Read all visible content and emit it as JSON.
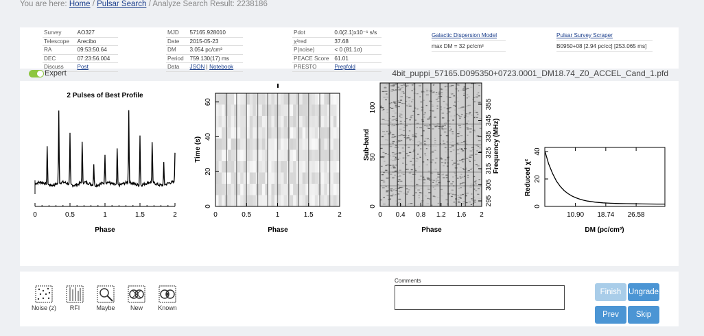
{
  "breadcrumb": {
    "prefix": "You are here:",
    "home": "Home",
    "sep1": "/",
    "search": "Pulsar Search",
    "sep2": "/",
    "current": "Analyze Search Result: 2238186"
  },
  "meta": {
    "col1": [
      {
        "k": "Survey",
        "v": "AO327"
      },
      {
        "k": "Telescope",
        "v": "Arecibo"
      },
      {
        "k": "RA",
        "v": "09:53:50.64"
      },
      {
        "k": "DEC",
        "v": "07:23:56.004"
      },
      {
        "k": "Discuss",
        "v": "Post",
        "link": true
      }
    ],
    "col2": [
      {
        "k": "MJD",
        "v": "57165.928010"
      },
      {
        "k": "Date",
        "v": "2015-05-23"
      },
      {
        "k": "DM",
        "v": "3.054 pc/cm³"
      },
      {
        "k": "Period",
        "v": "759.130(17) ms"
      }
    ],
    "col2_data": {
      "k": "Data",
      "json": "JSON",
      "sep": "|",
      "notebook": "Notebook"
    },
    "col3": [
      {
        "k": "Pdot",
        "v": "0.0(2.1)x10⁻⁶ s/s"
      },
      {
        "k": "χ²red",
        "v": "37.68"
      },
      {
        "k": "P(noise)",
        "v": "< 0   (81.1σ)"
      },
      {
        "k": "PEACE Score",
        "v": "61.01"
      },
      {
        "k": "PRESTO",
        "v": "Prepfold",
        "link": true
      }
    ],
    "gdm": {
      "link": "Galactic Dispersion Model",
      "value": "max DM = 32 pc/cm³"
    },
    "pss": {
      "link": "Pulsar Survey Scraper",
      "value": "B0950+08 [2.94 pc/cc] [253.065 ms]"
    }
  },
  "expert_label": "Expert",
  "filename": "4bit_puppi_57165.D095350+0723.0001_DM18.74_Z0_ACCEL_Cand_1.pfd",
  "chart_data": [
    {
      "type": "line",
      "title": "2 Pulses of Best Profile",
      "xlabel": "Phase",
      "ylabel": "",
      "xlim": [
        0,
        2
      ],
      "xticks": [
        "0",
        "0.5",
        "1",
        "1.5",
        "2"
      ],
      "peaks": [
        0.175,
        0.34,
        0.5,
        0.675,
        0.84,
        1.0,
        1.175,
        1.34,
        1.5,
        1.675,
        1.84,
        2.0
      ],
      "peak_heights": [
        0.55,
        1.0,
        0.7,
        0.6,
        0.3,
        0.4,
        0.55,
        1.0,
        0.7,
        0.6,
        0.3,
        0.4
      ]
    },
    {
      "type": "heatmap",
      "title": "",
      "xlabel": "Phase",
      "ylabel": "Time (s)",
      "xlim": [
        0,
        2
      ],
      "ylim": [
        0,
        65
      ],
      "xticks": [
        "0",
        "0.5",
        "1",
        "1.5",
        "2"
      ],
      "yticks": [
        "0",
        "20",
        "40",
        "60"
      ],
      "line_phases": [
        0.18,
        0.34,
        0.5,
        0.68,
        0.84,
        1.0,
        1.18,
        1.34,
        1.5,
        1.68,
        1.84
      ]
    },
    {
      "type": "heatmap",
      "title": "",
      "xlabel": "Phase",
      "ylabel": "Sub-band",
      "ylabel2": "Frequency (MHz)",
      "xlim": [
        0,
        2
      ],
      "ylim": [
        0,
        125
      ],
      "xticks": [
        "0",
        "0.4",
        "0.8",
        "1.2",
        "1.6",
        "2"
      ],
      "yticks": [
        "0",
        "50",
        "100"
      ],
      "freq_ticks": [
        "295",
        "305",
        "315",
        "325",
        "335",
        "345",
        "355"
      ],
      "line_phases": [
        0.18,
        0.34,
        0.5,
        0.68,
        0.84,
        1.0,
        1.18,
        1.34,
        1.5,
        1.68,
        1.84
      ]
    },
    {
      "type": "line",
      "title": "",
      "xlabel": "DM (pc/cm³)",
      "ylabel": "Reduced χ²",
      "xlim": [
        3,
        34
      ],
      "ylim": [
        0,
        43
      ],
      "xticks": [
        "10.90",
        "18.74",
        "26.58"
      ],
      "xtick_values": [
        10.9,
        18.74,
        26.58
      ],
      "yticks": [
        "0",
        "20",
        "40"
      ],
      "x": [
        3.05,
        4,
        5,
        6,
        7,
        8,
        9,
        10,
        11,
        12,
        13,
        14,
        16,
        18,
        20,
        22,
        24,
        26,
        28,
        30,
        32,
        34
      ],
      "y": [
        40,
        31,
        24,
        18.5,
        14.5,
        11.5,
        9.3,
        7.6,
        6.3,
        5.3,
        4.5,
        3.9,
        3.1,
        2.6,
        2.3,
        2.1,
        2.0,
        1.9,
        1.8,
        1.75,
        1.7,
        1.7
      ]
    }
  ],
  "classify": [
    {
      "label": "Noise (z)",
      "icon": "noise-icon"
    },
    {
      "label": "RFI",
      "icon": "rfi-icon"
    },
    {
      "label": "Maybe",
      "icon": "maybe-icon"
    },
    {
      "label": "New",
      "icon": "new-icon"
    },
    {
      "label": "Known",
      "icon": "known-icon"
    }
  ],
  "comments_label": "Comments",
  "buttons": {
    "finish": "Finish",
    "ungrade": "Ungrade",
    "prev": "Prev",
    "skip": "Skip"
  },
  "colors": {
    "primary_button": "#4b95d4",
    "disabled_button": "#a9cde9",
    "toggle_on": "#8dc63f"
  }
}
